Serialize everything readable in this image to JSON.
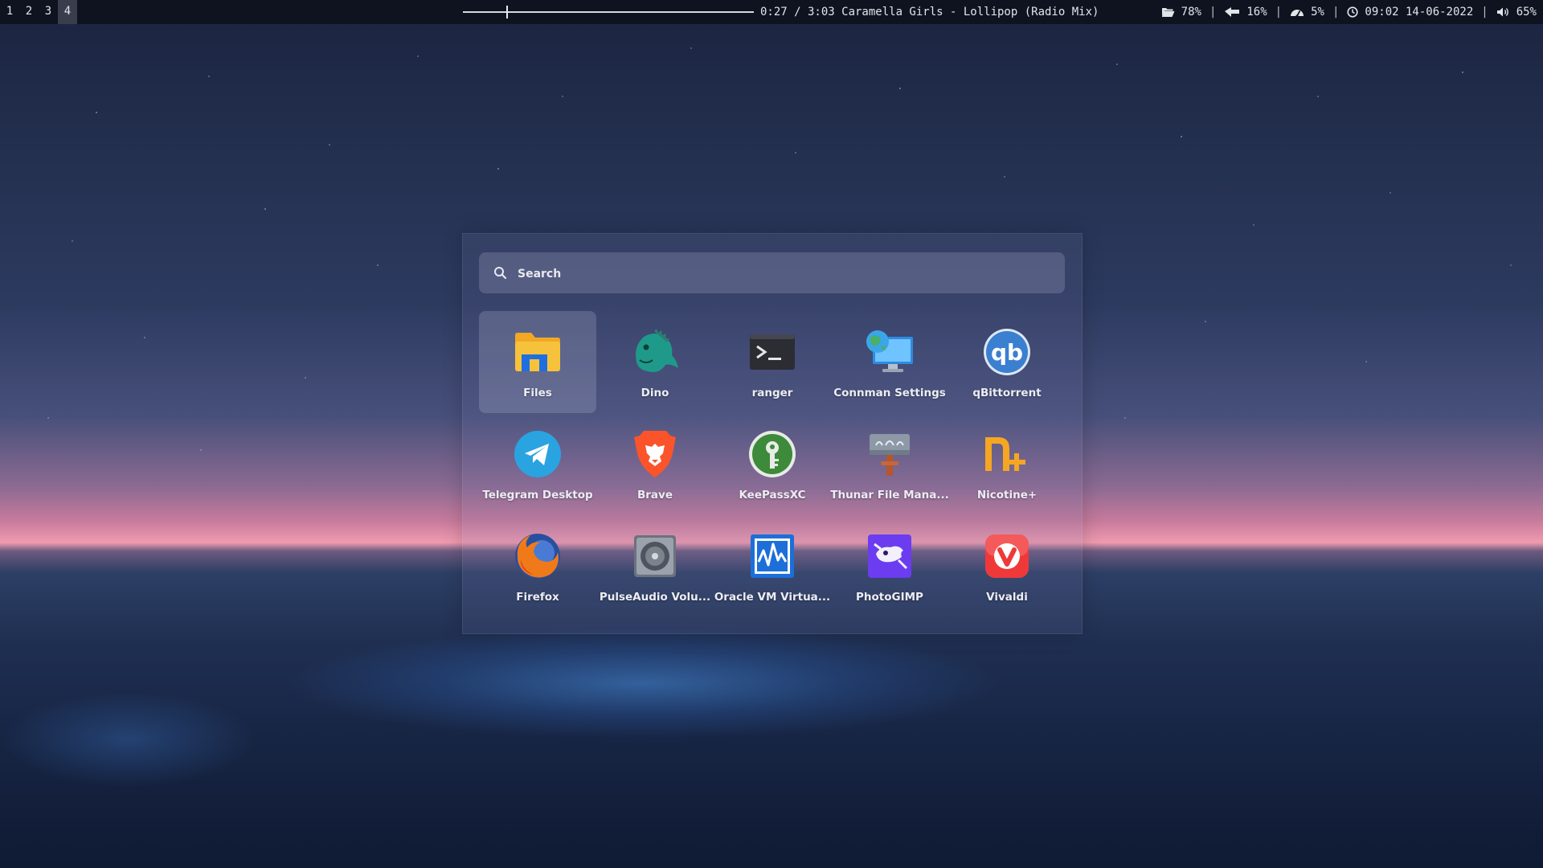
{
  "topbar": {
    "workspaces": [
      {
        "label": "1",
        "active": false
      },
      {
        "label": "2",
        "active": false
      },
      {
        "label": "3",
        "active": false
      },
      {
        "label": "4",
        "active": true
      }
    ],
    "media": {
      "progress_fraction": 0.148,
      "text": "0:27 / 3:03 Caramella Girls - Lollipop (Radio Mix)"
    },
    "status": {
      "disk": "78%",
      "cpu": "16%",
      "memory": "5%",
      "clock": "09:02 14-06-2022",
      "volume": "65%",
      "separator": "|"
    }
  },
  "launcher": {
    "search_placeholder": "Search",
    "selected_index": 0,
    "apps": [
      {
        "label": "Files",
        "icon": "folder-icon"
      },
      {
        "label": "Dino",
        "icon": "dino-icon"
      },
      {
        "label": "ranger",
        "icon": "terminal-icon"
      },
      {
        "label": "Connman Settings",
        "icon": "network-icon"
      },
      {
        "label": "qBittorrent",
        "icon": "qbittorrent-icon"
      },
      {
        "label": "Telegram Desktop",
        "icon": "telegram-icon"
      },
      {
        "label": "Brave",
        "icon": "brave-lion-icon"
      },
      {
        "label": "KeePassXC",
        "icon": "keepass-icon"
      },
      {
        "label": "Thunar File Mana...",
        "icon": "thunar-icon"
      },
      {
        "label": "Nicotine+",
        "icon": "nicotine-icon"
      },
      {
        "label": "Firefox",
        "icon": "firefox-icon"
      },
      {
        "label": "PulseAudio Volu...",
        "icon": "speaker-icon"
      },
      {
        "label": "Oracle VM Virtua...",
        "icon": "virtualbox-icon"
      },
      {
        "label": "PhotoGIMP",
        "icon": "gimp-icon"
      },
      {
        "label": "Vivaldi",
        "icon": "vivaldi-icon"
      }
    ]
  },
  "colors": {
    "bar_bg": "#0f1320",
    "bar_fg": "#e2e4ea",
    "files_yellow": "#f7c23b",
    "dino_teal": "#1f9a8a",
    "telegram_blue": "#2aa3e1",
    "brave_orange": "#fb542b",
    "vivaldi_red": "#ef3939",
    "gimp_purple": "#6b3cf0"
  }
}
